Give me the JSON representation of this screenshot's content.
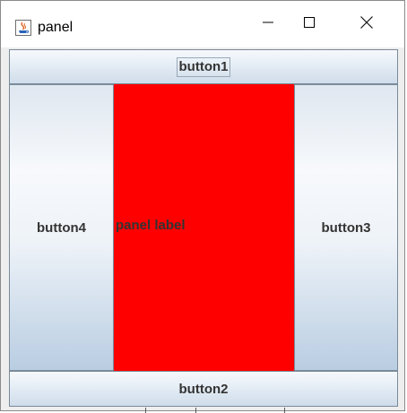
{
  "window": {
    "title": "panel"
  },
  "buttons": {
    "north": "button1",
    "south": "button2",
    "east": "button3",
    "west": "button4"
  },
  "center_panel": {
    "label": "panel label",
    "color": "#ff0000"
  },
  "icons": {
    "app": "java-cup-icon",
    "minimize": "minimize-icon",
    "maximize": "maximize-icon",
    "close": "close-icon"
  }
}
